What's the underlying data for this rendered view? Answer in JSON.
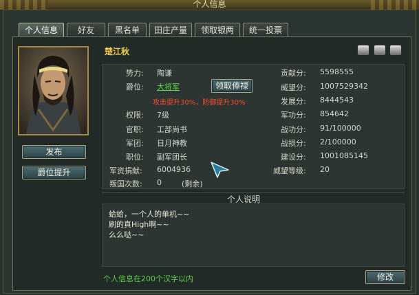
{
  "window": {
    "title": "个人信息"
  },
  "tabs": [
    {
      "label": "个人信息",
      "active": true
    },
    {
      "label": "好友",
      "active": false
    },
    {
      "label": "黑名单",
      "active": false
    },
    {
      "label": "田庄产量",
      "active": false
    },
    {
      "label": "领取银两",
      "active": false
    },
    {
      "label": "统一投票",
      "active": false
    }
  ],
  "profile": {
    "name": "楚江秋",
    "publish_button": "发布",
    "rank_up_button": "爵位提升"
  },
  "info": {
    "force_label": "势力:",
    "force_value": "陶谦",
    "title_label": "爵位:",
    "title_value": "大将军",
    "salary_button": "领取俸禄",
    "bonus_text": "攻击提升30%，防御提升30%",
    "permission_label": "权限:",
    "permission_value": "7级",
    "office_label": "官职:",
    "office_value": "工部尚书",
    "legion_label": "军团:",
    "legion_value": "日月神教",
    "post_label": "职位:",
    "post_value": "副军团长",
    "donation_label": "军资捐献:",
    "donation_value": "6004936",
    "betray_label": "叛国次数:",
    "betray_value": "0",
    "betray_note": "(剩余)",
    "contribution_label": "贡献分:",
    "contribution_value": "5598555",
    "prestige_label": "威望分:",
    "prestige_value": "1007529342",
    "development_label": "发展分:",
    "development_value": "8444543",
    "military_label": "军功分:",
    "military_value": "854642",
    "battle_label": "战功分:",
    "battle_value": "91/100000",
    "loss_label": "战损分:",
    "loss_value": "2/100000",
    "build_label": "建设分:",
    "build_value": "1001085145",
    "prestige_level_label": "威望等级:",
    "prestige_level_value": "20"
  },
  "description": {
    "heading": "个人说明",
    "lines": [
      "蛤蛤，一个人的单机~~",
      "刷的真High啊~~",
      "么么哒~~"
    ],
    "hint": "个人信息在200个汉字以内",
    "edit_button": "修改"
  },
  "colors": {
    "accent_name": "#f2d04e",
    "link_green": "#5fd54b",
    "bonus_red": "#ff4a2e",
    "hint_green": "#5fcf49"
  },
  "icons": [
    "helmet-icon",
    "armor-icon",
    "weapon-icon"
  ]
}
